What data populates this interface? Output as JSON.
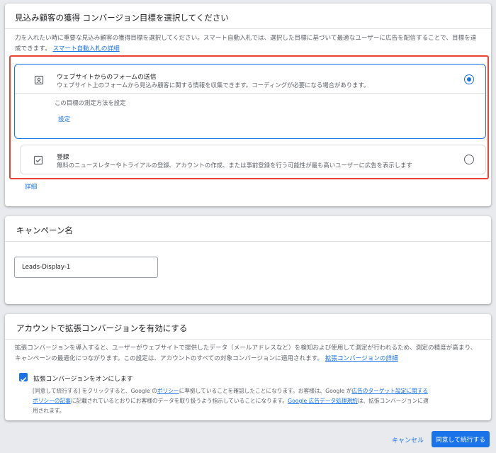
{
  "goal_section": {
    "title": "見込み顧客の獲得 コンバージョン目標を選択してください",
    "description": "力を入れたい時に重要な見込み顧客の獲得目標を選択してください。スマート自動入札では、選択した目標に基づいて最適なユーザーに広告を配信することで、目標を達成できます。",
    "learn_more_link": "スマート自動入札の詳細",
    "options": [
      {
        "title": "ウェブサイトからのフォームの送信",
        "subtitle": "ウェブサイト上のフォームから見込み顧客に関する情報を収集できます。コーディングが必要になる場合があります。",
        "icon": "contact-form-icon",
        "selected": true,
        "measure_label": "この目標の測定方法を設定",
        "setup_link": "設定"
      },
      {
        "title": "登録",
        "subtitle": "無料のニュースレターやトライアルの登録、アカウントの作成、または事前登録を行う可能性が最も高いユーザーに広告を表示します",
        "icon": "checkbox-clipboard-icon",
        "selected": false
      }
    ],
    "details_link": "詳細"
  },
  "campaign_name": {
    "title": "キャンペーン名",
    "value": "Leads-Display-1"
  },
  "enhanced_conversions": {
    "title": "アカウントで拡張コンバージョンを有効にする",
    "description": "拡張コンバージョンを導入すると、ユーザーがウェブサイトで提供したデータ（メールアドレスなど）を検知および使用して測定が行われるため、測定の精度が高まり、キャンペーンの最適化につながります。この設定は、アカウントのすべての対象コンバージョンに適用されます。",
    "details_link": "拡張コンバージョンの詳細",
    "checkbox_label": "拡張コンバージョンをオンにします",
    "checked": true,
    "policy_text_1": "[同意して続行する] をクリックすると、Google の",
    "policy_link_1": "ポリシー",
    "policy_text_2": "に準拠していることを確認したことになります。お客様は、Google が",
    "policy_link_2": "広告のターゲット設定に関するポリシーの記事",
    "policy_text_3": "に記載されているとおりにお客様のデータを取り扱うよう指示していることになります。",
    "policy_link_3": "Google 広告データ処理規約",
    "policy_text_4": "は、拡張コンバージョンに適用されます。"
  },
  "footer": {
    "cancel_label": "キャンセル",
    "continue_label": "同意して続行する"
  },
  "colors": {
    "accent": "#1a73e8",
    "highlight_border": "#ea4335"
  }
}
